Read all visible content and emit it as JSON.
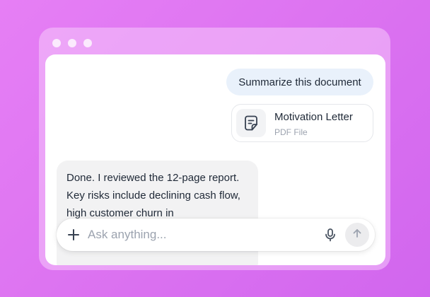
{
  "chat": {
    "user_message": "Summarize this document",
    "attachment": {
      "name": "Motivation Letter",
      "type": "PDF File",
      "icon": "document-icon"
    },
    "assistant_message": "Done. I reviewed the 12-page report.    Key risks include declining cash flow, high customer churn in"
  },
  "composer": {
    "placeholder": "Ask anything...",
    "icons": [
      "plus-icon",
      "microphone-icon",
      "send-arrow-icon"
    ]
  },
  "colors": {
    "background": "#dd74f1",
    "user_bubble": "#e9f1fb",
    "assistant_bubble": "#f2f2f3"
  }
}
